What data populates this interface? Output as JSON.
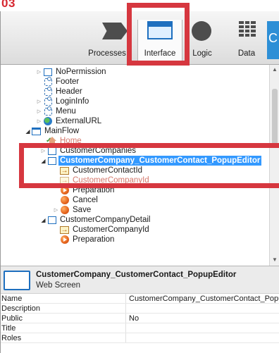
{
  "step_number": "03",
  "toolbar": {
    "tabs": [
      {
        "label": "Processes",
        "icon": "processes-icon"
      },
      {
        "label": "Interface",
        "icon": "interface-icon"
      },
      {
        "label": "Logic",
        "icon": "logic-icon"
      },
      {
        "label": "Data",
        "icon": "data-icon"
      }
    ],
    "edge_tab_text": "C"
  },
  "tree": {
    "items": [
      {
        "label": "NoPermission",
        "icon": "web-screen-icon"
      },
      {
        "label": "Footer",
        "icon": "web-block-icon"
      },
      {
        "label": "Header",
        "icon": "web-block-icon"
      },
      {
        "label": "LoginInfo",
        "icon": "web-block-icon"
      },
      {
        "label": "Menu",
        "icon": "web-block-icon"
      },
      {
        "label": "ExternalURL",
        "icon": "globe-icon"
      },
      {
        "label": "MainFlow",
        "icon": "ui-flow-icon"
      },
      {
        "label": "Home",
        "icon": "home-icon"
      },
      {
        "label": "CustomerCompanies",
        "icon": "web-screen-icon"
      },
      {
        "label": "CustomerCompany_CustomerContact_PopupEditor",
        "icon": "web-screen-icon"
      },
      {
        "label": "CustomerContactId",
        "icon": "input-parameter-icon"
      },
      {
        "label": "CustomerCompanyId",
        "icon": "input-parameter-icon"
      },
      {
        "label": "Preparation",
        "icon": "screen-action-icon"
      },
      {
        "label": "Cancel",
        "icon": "screen-action-icon"
      },
      {
        "label": "Save",
        "icon": "screen-action-icon"
      },
      {
        "label": "CustomerCompanyDetail",
        "icon": "web-screen-icon"
      },
      {
        "label": "CustomerCompanyId",
        "icon": "input-parameter-icon"
      },
      {
        "label": "Preparation",
        "icon": "screen-action-icon"
      }
    ]
  },
  "properties": {
    "title": "CustomerCompany_CustomerContact_PopupEditor",
    "subtitle": "Web Screen",
    "rows": [
      {
        "key": "Name",
        "value": "CustomerCompany_CustomerContact_PopupEditor"
      },
      {
        "key": "Description",
        "value": ""
      },
      {
        "key": "Public",
        "value": "No"
      },
      {
        "key": "Title",
        "value": ""
      },
      {
        "key": "Roles",
        "value": ""
      }
    ]
  },
  "colors": {
    "highlight": "#d6373f",
    "selection": "#3399ff",
    "accent": "#1e6fbf"
  }
}
